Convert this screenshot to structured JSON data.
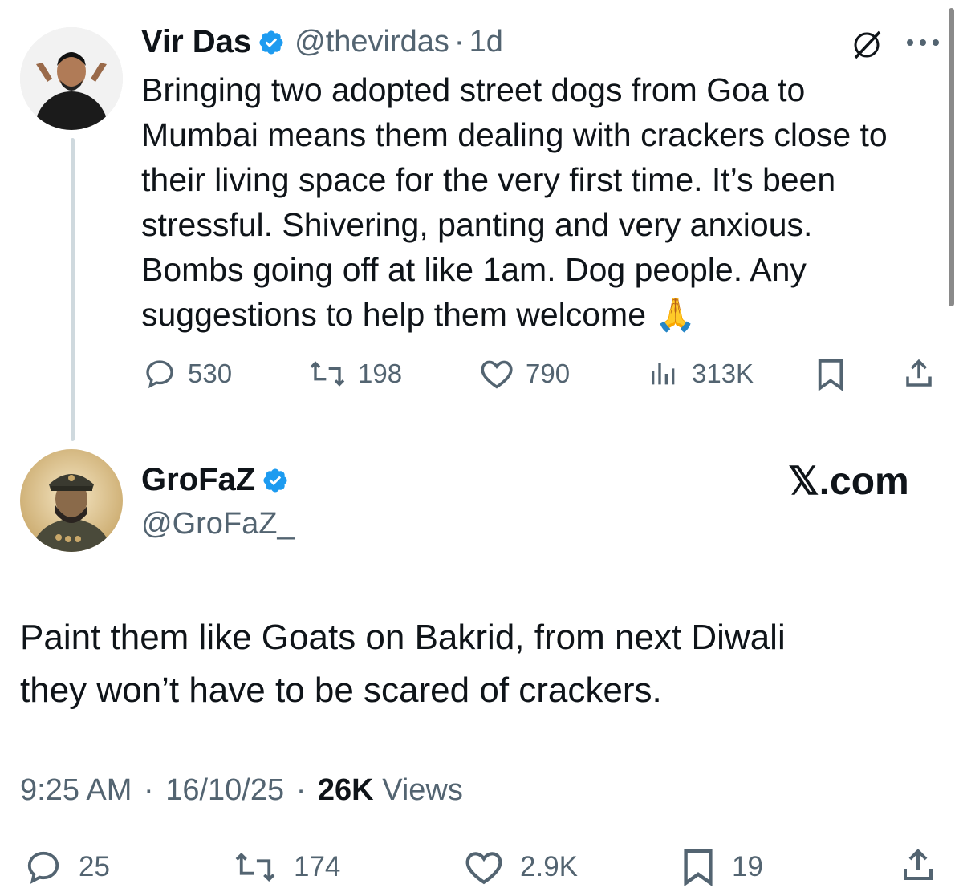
{
  "original_tweet": {
    "author_name": "Vir Das",
    "handle": "@thevirdas",
    "separator": "·",
    "time": "1d",
    "text_lines": [
      "Bringing two adopted street dogs from Goa to",
      "Mumbai means them dealing with crackers close to",
      "their living space for the very first time. It’s been",
      "stressful. Shivering, panting and very anxious.",
      "Bombs going off at like 1am. Dog people. Any",
      "suggestions to help them welcome 🙏"
    ],
    "replies": "530",
    "reposts": "198",
    "likes": "790",
    "views": "313K"
  },
  "reply_tweet": {
    "author_name": "GroFaZ",
    "handle": "@GroFaZ_",
    "watermark": "𝕏.com",
    "text_lines": [
      "Paint them like Goats on Bakrid, from next Diwali",
      "they won’t have to be scared of crackers."
    ],
    "time": "9:25 AM",
    "date": "16/10/25",
    "separator": "·",
    "view_count": "26K",
    "view_label": "Views",
    "replies": "25",
    "reposts": "174",
    "likes": "2.9K",
    "bookmarks": "19"
  },
  "colors": {
    "text": "#0f1419",
    "secondary": "#536471",
    "verified": "#1d9bf0",
    "thread_line": "#cfd9de"
  },
  "icons": [
    "verified-badge-icon",
    "grok-icon",
    "more-icon",
    "reply-icon",
    "repost-icon",
    "like-icon",
    "views-icon",
    "bookmark-icon",
    "share-icon"
  ]
}
